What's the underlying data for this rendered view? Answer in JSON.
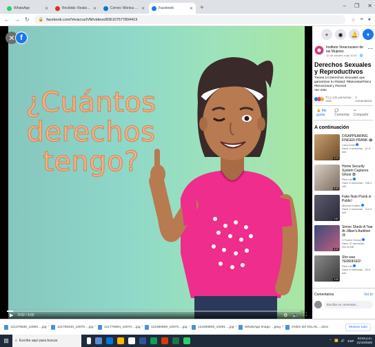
{
  "browser": {
    "tabs": [
      {
        "title": "WhatsApp",
        "color": "#25d366",
        "active": false
      },
      {
        "title": "Recibido: Realizar Facebook e impartir…",
        "color": "#d93025",
        "active": false
      },
      {
        "title": "Correo: Mónica Gabriel Bernal…",
        "color": "#0078d4",
        "active": false
      },
      {
        "title": "Facebook",
        "color": "#1877f2",
        "active": true
      }
    ],
    "new_tab": "+",
    "url": "facebook.com/VeracruzIVM/videos/836107577804419",
    "window_controls": [
      "–",
      "❐",
      "✕"
    ]
  },
  "video": {
    "title_text": "¿Cuántos derechos tengo?",
    "title_lines": [
      "¿Cuántos",
      "derechos",
      "tengo?"
    ],
    "close_icon": "✕",
    "fb_icon": "f",
    "time": "0:02 / 3:02",
    "progress": 0.02
  },
  "panel": {
    "top_buttons": [
      "+",
      "◉",
      "🔔",
      "▾"
    ],
    "page_name": "Instituto Veracruzano de las Mujeres",
    "page_date": "12 de octubre a las 10:01 · 🌐",
    "post_title": "Derechos Sexuales y Reproductivos",
    "post_desc": "Tienes 14 Derechos Sexuales que garantizan tu #Salud, #BienestarFisico #Emocional y #Social",
    "see_more": "Ver más",
    "reactions_text": "Tú y 131 personas más",
    "comments_count": "3 comentarios",
    "actions": {
      "like": "Me gusta",
      "comment": "Comentar",
      "share": "Compartir"
    },
    "next_heading": "A continuación",
    "suggestions": [
      {
        "title": "DISAPPEARING FINGER PRANK 😂",
        "author": "Lakul Dahl",
        "meta": "Hace 4 semanas · 67.5 mill.",
        "duration": "0:23",
        "c1": "#c8a070",
        "c2": "#6b4a2a"
      },
      {
        "title": "Home Security System Captures Ghost 😨",
        "author": "Rick Lax",
        "meta": "Hace 6 semanas · 196.2 mill.",
        "duration": "0:43",
        "c1": "#d9d0c8",
        "c2": "#7a6a5a"
      },
      {
        "title": "Fake Nuts Prank in Public!",
        "author": "Michael Kalisin",
        "meta": "Hace 2 semanas · 112.4 mill.",
        "duration": "0:50",
        "c1": "#5a5a6a",
        "c2": "#2a2a3a"
      },
      {
        "title": "Simon Sheds A Tear At Jillian's Audition 😢",
        "author": "X Factor Global",
        "meta": "Hace 27 semanas · 251.8 mill.",
        "duration": "3:20",
        "c1": "#3a4a7a",
        "c2": "#c06080"
      },
      {
        "title": "She was TERRIFIED!",
        "author": "Rick Lax",
        "meta": "Hace 8 semanas · 62.8 mill.",
        "duration": "1:20",
        "c1": "#8a8a8a",
        "c2": "#3a3a3a"
      }
    ],
    "comments_label": "Comentarios",
    "see_all": "Ver to",
    "comment_placeholder": "Escribe un comentari…"
  },
  "downloads": [
    "121376830_10000….jpg",
    "121768340_10070….jpg",
    "121775904_10070….jpg",
    "121860669_10070….jpg",
    "121808609_10091….jpg",
    "WhatsApp Image….jpeg",
    "Orden del Día.Ab….docx"
  ],
  "downloads_show_all": "Mostrar todo",
  "taskbar": {
    "search_placeholder": "Escribe aquí para buscar",
    "time": "04:04 p.m.",
    "date": "21/10/2020",
    "lang": "ESP"
  },
  "colors": {
    "facebook_blue": "#1877f2",
    "video_bg_start": "#86c6be",
    "video_bg_end": "#a9e6a3",
    "title_text": "#f3b489",
    "shirt": "#ee2d8c"
  }
}
